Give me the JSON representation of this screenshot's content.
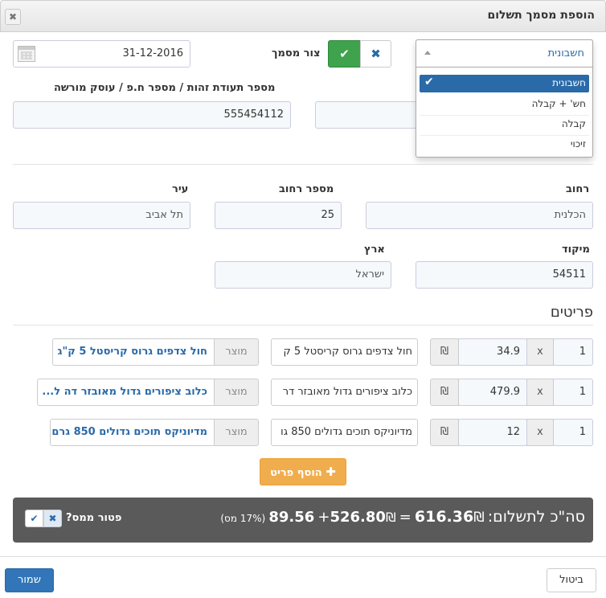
{
  "dialog": {
    "title": "הוספת מסמך תשלום",
    "close_glyph": "✖"
  },
  "doc_type": {
    "selected": "חשבונית",
    "options": [
      "חשבונית",
      "חש' + קבלה",
      "קבלה",
      "זיכוי"
    ]
  },
  "create_doc": {
    "label": "צור מסמך"
  },
  "date": {
    "value": "31-12-2016"
  },
  "id_label": "מספר תעודת זהות / מספר ח.פ / עוסק מורשה",
  "id_value": "555454112",
  "address": {
    "street_label": "רחוב",
    "street_value": "הכלנית",
    "number_label": "מספר רחוב",
    "number_value": "25",
    "city_label": "עיר",
    "city_value": "תל אביב",
    "zip_label": "מיקוד",
    "zip_value": "54511",
    "country_label": "ארץ",
    "country_value": "ישראל"
  },
  "items_title": "פריטים",
  "items": [
    {
      "qty": "1",
      "times": "x",
      "price": "34.9",
      "currency": "₪",
      "desc": "חול צדפים גרוס קריסטל 5 ק",
      "product_label": "מוצר",
      "product": "חול צדפים גרוס קריסטל 5 ק\"ג"
    },
    {
      "qty": "1",
      "times": "x",
      "price": "479.9",
      "currency": "₪",
      "desc": "כלוב ציפורים גדול מאובזר דר",
      "product_label": "מוצר",
      "product": "כלוב ציפורים גדול מאובזר דה ל..."
    },
    {
      "qty": "1",
      "times": "x",
      "price": "12",
      "currency": "₪",
      "desc": "מדיוניקס תוכים גדולים 850 גו",
      "product_label": "מוצר",
      "product": "מדיוניקס תוכים גדולים 850 גרם"
    }
  ],
  "add_item": {
    "label": "הוסף פריט"
  },
  "totals": {
    "label": "סה\"כ לתשלום:",
    "total": "616.36",
    "currency": "₪",
    "equals": "=",
    "subtotal": "526.80",
    "plus": "+",
    "tax": "89.56",
    "tax_note": "(17% מס)",
    "tax_exempt_label": "פטור ממס?"
  },
  "footer": {
    "cancel_label": "ביטול",
    "save_label": "שמור"
  },
  "colors": {
    "green": "#3fa34d",
    "blue": "#2a6aa8",
    "orange": "#f0ad4e",
    "dark_bar": "#5a5a5a",
    "save": "#3275b8"
  }
}
